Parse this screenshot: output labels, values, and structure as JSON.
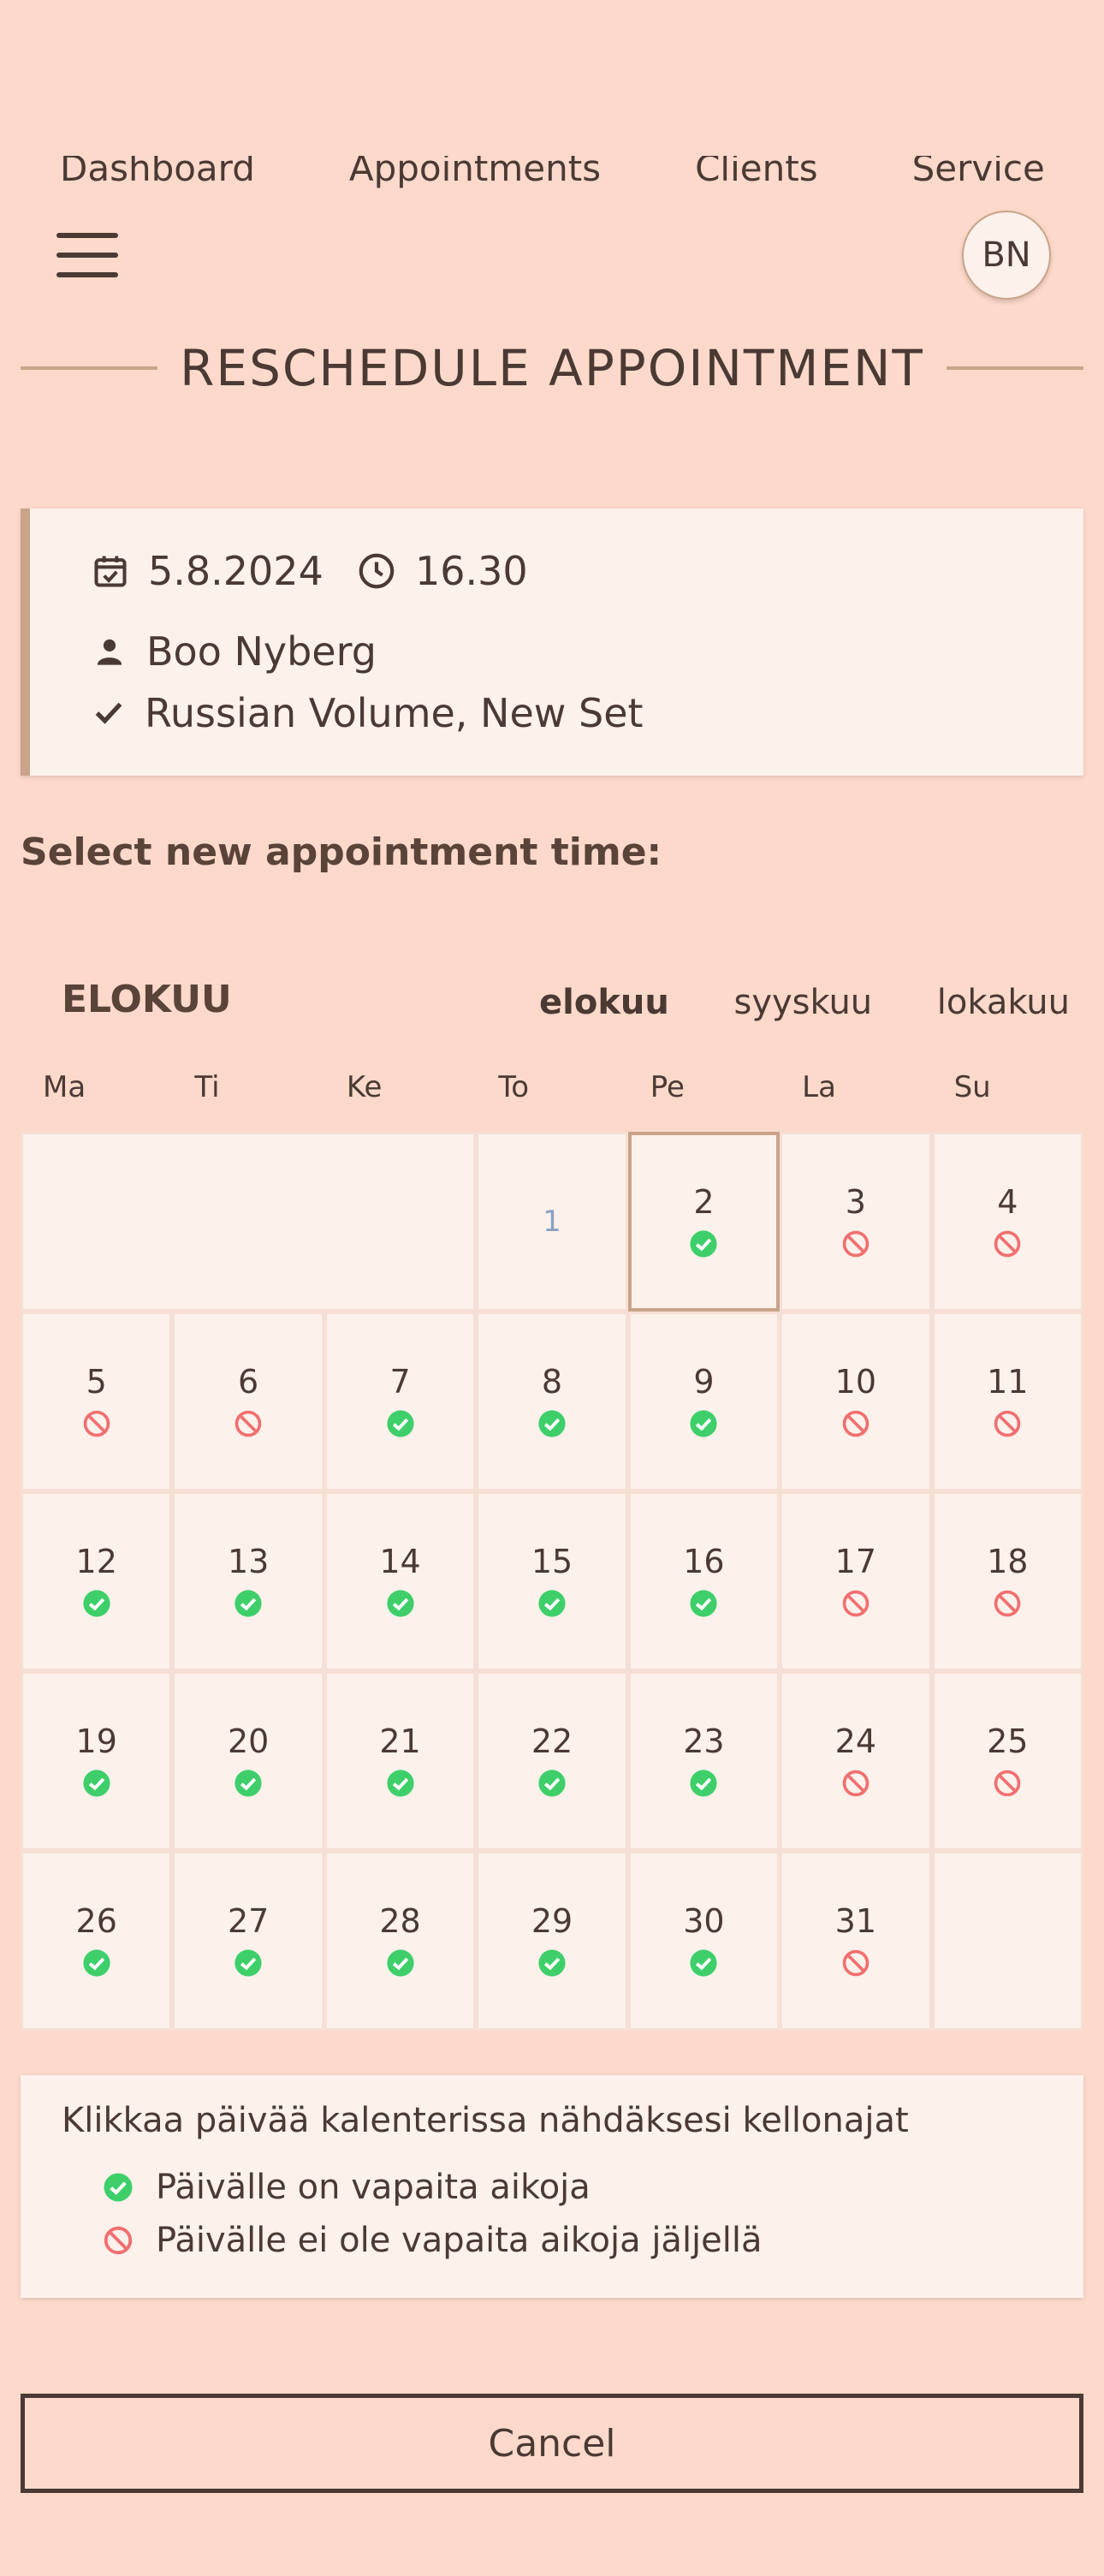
{
  "nav": {
    "items": [
      "Dashboard",
      "Appointments",
      "Clients",
      "Services"
    ]
  },
  "header": {
    "avatar_initials": "BN"
  },
  "page_title": "RESCHEDULE APPOINTMENT",
  "appointment": {
    "date": "5.8.2024",
    "time": "16.30",
    "client": "Boo Nyberg",
    "service": "Russian Volume, New Set"
  },
  "select_label": "Select new appointment time:",
  "calendar": {
    "month_title": "ELOKUU",
    "month_tabs": [
      "elokuu",
      "syyskuu",
      "lokakuu"
    ],
    "active_tab": "elokuu",
    "weekdays": [
      "Ma",
      "Ti",
      "Ke",
      "To",
      "Pe",
      "La",
      "Su"
    ],
    "selected_day": 2,
    "days": [
      {
        "day": "1",
        "status": "none"
      },
      {
        "day": "2",
        "status": "available"
      },
      {
        "day": "3",
        "status": "full"
      },
      {
        "day": "4",
        "status": "full"
      },
      {
        "day": "5",
        "status": "full"
      },
      {
        "day": "6",
        "status": "full"
      },
      {
        "day": "7",
        "status": "available"
      },
      {
        "day": "8",
        "status": "available"
      },
      {
        "day": "9",
        "status": "available"
      },
      {
        "day": "10",
        "status": "full"
      },
      {
        "day": "11",
        "status": "full"
      },
      {
        "day": "12",
        "status": "available"
      },
      {
        "day": "13",
        "status": "available"
      },
      {
        "day": "14",
        "status": "available"
      },
      {
        "day": "15",
        "status": "available"
      },
      {
        "day": "16",
        "status": "available"
      },
      {
        "day": "17",
        "status": "full"
      },
      {
        "day": "18",
        "status": "full"
      },
      {
        "day": "19",
        "status": "available"
      },
      {
        "day": "20",
        "status": "available"
      },
      {
        "day": "21",
        "status": "available"
      },
      {
        "day": "22",
        "status": "available"
      },
      {
        "day": "23",
        "status": "available"
      },
      {
        "day": "24",
        "status": "full"
      },
      {
        "day": "25",
        "status": "full"
      },
      {
        "day": "26",
        "status": "available"
      },
      {
        "day": "27",
        "status": "available"
      },
      {
        "day": "28",
        "status": "available"
      },
      {
        "day": "29",
        "status": "available"
      },
      {
        "day": "30",
        "status": "available"
      },
      {
        "day": "31",
        "status": "full"
      }
    ]
  },
  "legend": {
    "hint": "Klikkaa päivää kalenterissa nähdäksesi kellonajat",
    "available": "Päivälle on vapaita aikoja",
    "full": "Päivälle ei ole vapaita aikoja jäljellä"
  },
  "cancel_label": "Cancel",
  "colors": {
    "background": "#fcd9cb",
    "card": "#fdf1ec",
    "accent": "#c9a48a",
    "available": "#3ecf6a",
    "full": "#f07070",
    "text": "#4a3a33"
  }
}
